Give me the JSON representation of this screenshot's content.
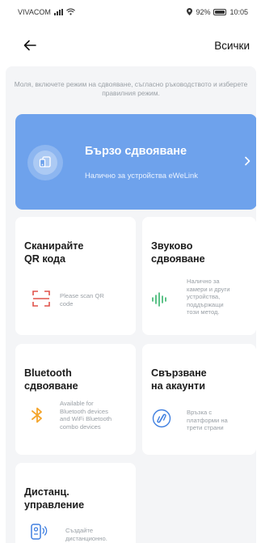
{
  "status_bar": {
    "carrier": "VIVACOM",
    "battery_text": "92%",
    "battery_level": 0.92,
    "time": "10:05"
  },
  "header": {
    "all_label": "Всички"
  },
  "hint": "Моля, включете режим на сдвояване, съгласно ръководството и изберете правилния режим.",
  "quick_pair": {
    "title": "Бързо сдвояване",
    "subtitle": "Налично за устройства eWeLink"
  },
  "cards": {
    "qr": {
      "title_line1": "Сканирайте",
      "title_line2": "QR кода",
      "desc_line1": "Please scan QR",
      "desc_line2": "code"
    },
    "sound": {
      "title_line1": "Звуково",
      "title_line2": "сдвояване",
      "desc_line1": "Налично за",
      "desc_line2": "камери и други",
      "desc_line3": "устройства,",
      "desc_line4": "поддържащи",
      "desc_line5": "този метод."
    },
    "bluetooth": {
      "title_line1": "Bluetooth",
      "title_line2": "сдвояване",
      "desc_line1": "Available for",
      "desc_line2": "Bluetooth devices",
      "desc_line3": "and WiFi Bluetooth",
      "desc_line4": "combo devices"
    },
    "account": {
      "title_line1": "Свързване",
      "title_line2": "на акаунти",
      "desc_line1": "Връзка с",
      "desc_line2": "платформи на",
      "desc_line3": "трети страни"
    },
    "remote": {
      "title_line1": "Дистанц.",
      "title_line2": "управление",
      "desc_line1": "Създайте",
      "desc_line2": "дистанционно."
    }
  },
  "colors": {
    "accent": "#6ea2ec",
    "qr_icon": "#e0524a",
    "sound_icon": "#34b36b",
    "bluetooth_icon": "#f4a52c",
    "account_icon": "#3f7fe0",
    "remote_icon": "#3f7fe0"
  }
}
